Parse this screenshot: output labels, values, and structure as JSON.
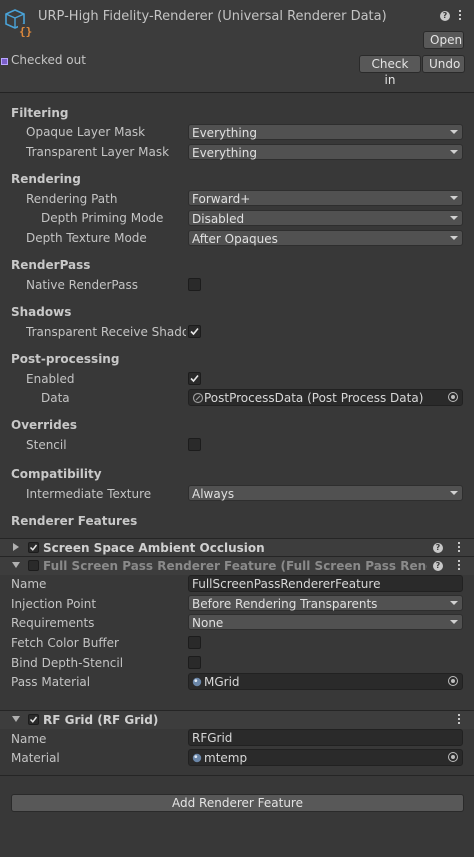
{
  "header": {
    "title": "URP-High Fidelity-Renderer (Universal Renderer Data)",
    "open_label": "Open",
    "checked_out_label": "Checked out",
    "check_in_label": "Check in",
    "undo_label": "Undo"
  },
  "filtering": {
    "section": "Filtering",
    "opaque_label": "Opaque Layer Mask",
    "opaque_value": "Everything",
    "transparent_label": "Transparent Layer Mask",
    "transparent_value": "Everything"
  },
  "rendering": {
    "section": "Rendering",
    "path_label": "Rendering Path",
    "path_value": "Forward+",
    "depth_priming_label": "Depth Priming Mode",
    "depth_priming_value": "Disabled",
    "depth_texture_label": "Depth Texture Mode",
    "depth_texture_value": "After Opaques"
  },
  "renderpass": {
    "section": "RenderPass",
    "native_label": "Native RenderPass",
    "native_checked": false
  },
  "shadows": {
    "section": "Shadows",
    "receive_label": "Transparent Receive Shadows",
    "receive_checked": true
  },
  "postprocessing": {
    "section": "Post-processing",
    "enabled_label": "Enabled",
    "enabled_checked": true,
    "data_label": "Data",
    "data_value": "PostProcessData (Post Process Data)"
  },
  "overrides": {
    "section": "Overrides",
    "stencil_label": "Stencil",
    "stencil_checked": false
  },
  "compatibility": {
    "section": "Compatibility",
    "intermediate_label": "Intermediate Texture",
    "intermediate_value": "Always"
  },
  "renderer_features": {
    "section": "Renderer Features",
    "ssao": {
      "title": "Screen Space Ambient Occlusion",
      "enabled": true
    },
    "fullscreen": {
      "title": "Full Screen Pass Renderer Feature (Full Screen Pass Renderer Feat",
      "enabled": false,
      "name_label": "Name",
      "name_value": "FullScreenPassRendererFeature",
      "injection_label": "Injection Point",
      "injection_value": "Before Rendering Transparents",
      "requirements_label": "Requirements",
      "requirements_value": "None",
      "fetch_label": "Fetch Color Buffer",
      "bind_label": "Bind Depth-Stencil",
      "material_label": "Pass Material",
      "material_value": "MGrid"
    },
    "rfgrid": {
      "title": "RF Grid (RF Grid)",
      "enabled": true,
      "name_label": "Name",
      "name_value": "RFGrid",
      "material_label": "Material",
      "material_value": "mtemp"
    },
    "add_label": "Add Renderer Feature"
  },
  "colors": {
    "background": "#383838",
    "header": "#3c3c3c",
    "field": "#2a2a2a",
    "accent_icon": "#4aa3d8",
    "badge": "#7b5fc9"
  }
}
